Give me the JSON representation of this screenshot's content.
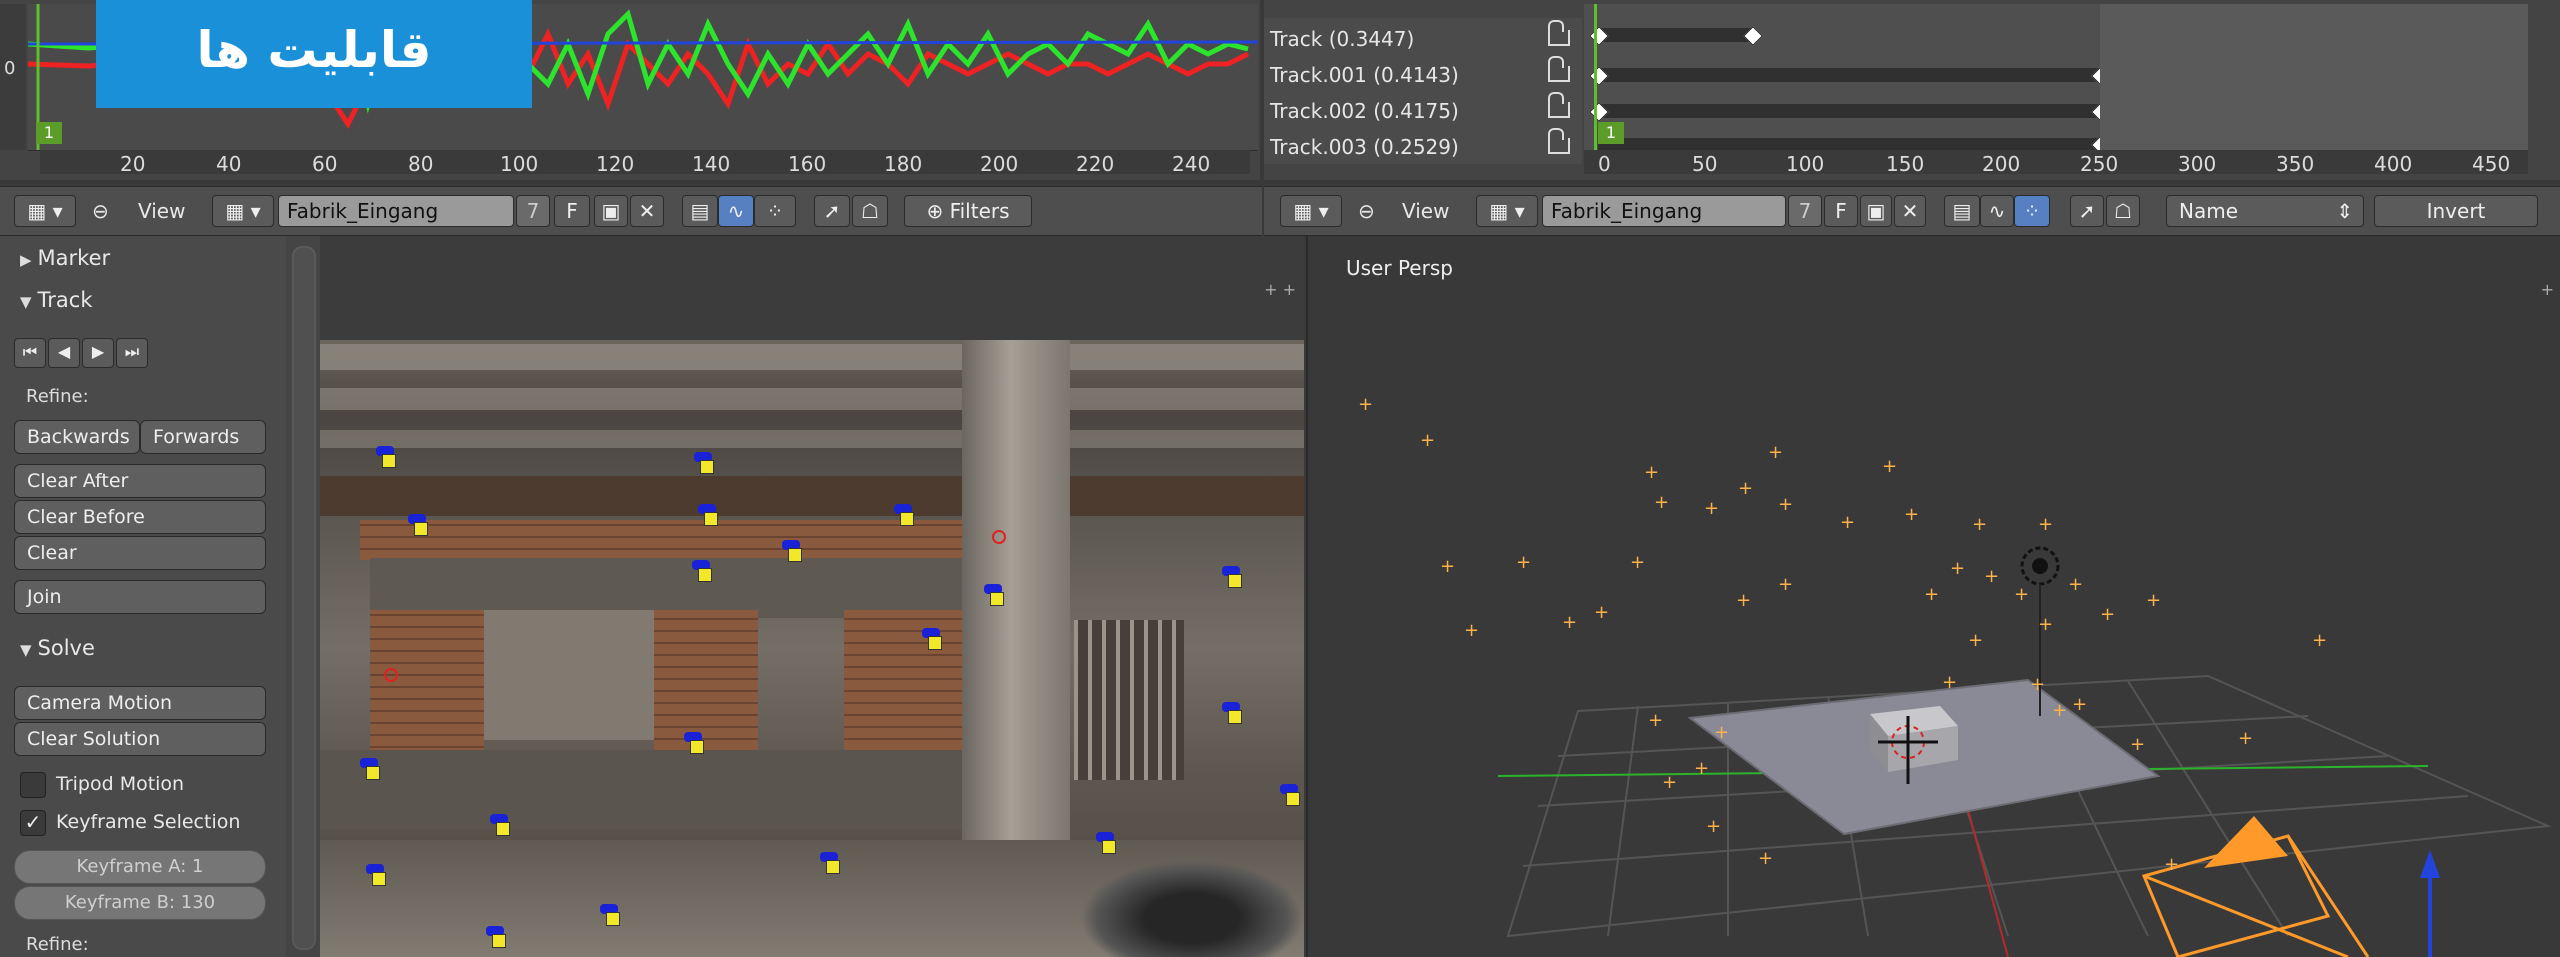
{
  "logo": {
    "text": "قابلیت ها"
  },
  "graph_editor": {
    "zero_label": "0",
    "frame_badge": "1",
    "ruler_ticks": [
      "20",
      "40",
      "60",
      "80",
      "100",
      "120",
      "140",
      "160",
      "180",
      "200",
      "220",
      "240"
    ]
  },
  "dopesheet": {
    "tracks": [
      {
        "label": "Track (0.3447)"
      },
      {
        "label": "Track.001 (0.4143)"
      },
      {
        "label": "Track.002 (0.4175)"
      },
      {
        "label": "Track.003 (0.2529)"
      }
    ],
    "frame_badge": "1",
    "ruler_ticks": [
      "0",
      "50",
      "100",
      "150",
      "200",
      "250",
      "300",
      "350",
      "400",
      "450"
    ]
  },
  "left_header": {
    "view_label": "View",
    "datablock": "Fabrik_Eingang",
    "users": "7",
    "fake_user": "F",
    "filters_label": "Filters"
  },
  "right_header": {
    "view_label": "View",
    "datablock": "Fabrik_Eingang",
    "users": "7",
    "fake_user": "F",
    "sort_value": "Name",
    "invert_label": "Invert"
  },
  "tools_panel": {
    "marker_label": "Marker",
    "track_label": "Track",
    "refine_label": "Refine:",
    "backwards": "Backwards",
    "forwards": "Forwards",
    "clear_after": "Clear After",
    "clear_before": "Clear Before",
    "clear": "Clear",
    "join": "Join",
    "solve_label": "Solve",
    "camera_motion": "Camera Motion",
    "clear_solution": "Clear Solution",
    "tripod_motion": "Tripod Motion",
    "keyframe_selection": "Keyframe Selection",
    "keyframe_a": "Keyframe A: 1",
    "keyframe_b": "Keyframe B: 130",
    "refine2_label": "Refine:"
  },
  "viewport": {
    "label": "User Persp"
  },
  "colors": {
    "accent": "#5680c2",
    "frame_green": "#5c9d2a",
    "marker_blue": "#1a22d8",
    "marker_yellow": "#f3e72a",
    "logo_blue": "#1a90d8"
  }
}
